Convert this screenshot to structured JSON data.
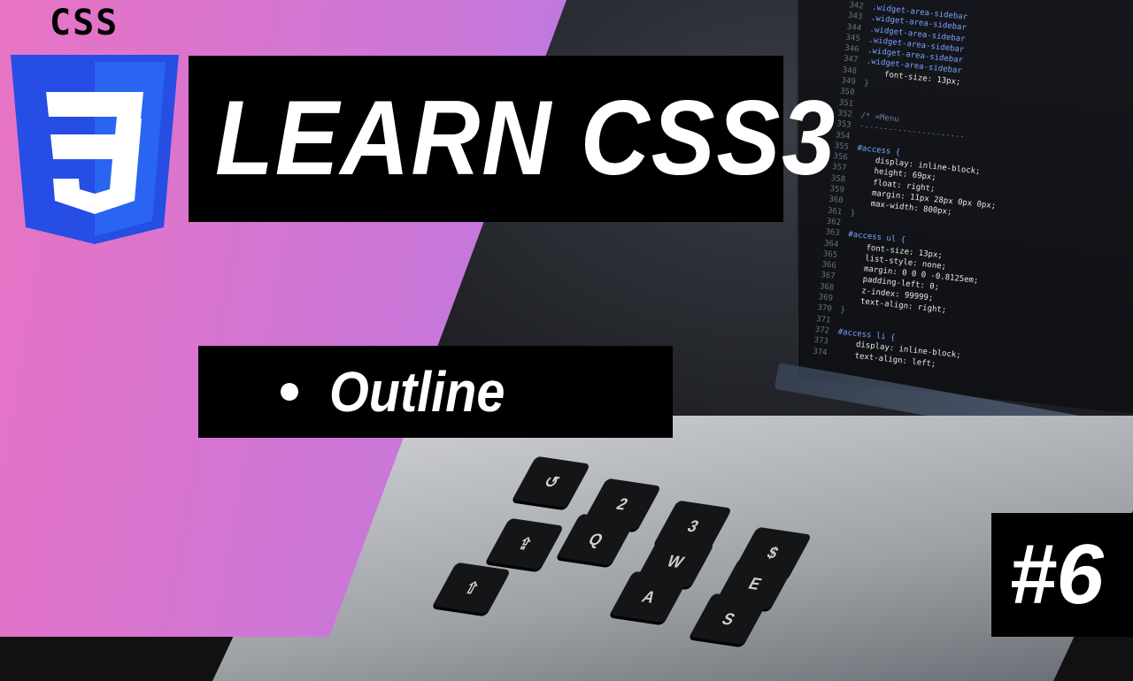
{
  "logo": {
    "text": "CSS",
    "icon": "css3-shield-icon",
    "colors": {
      "shield": "#264de4",
      "shield_light": "#2965f1"
    }
  },
  "title": "LEARN  CSS3",
  "topic": {
    "bullet": "•",
    "label": "Outline"
  },
  "episode": "#6",
  "colors": {
    "gradient_start": "#e873c4",
    "gradient_end": "#8a80ff",
    "banner": "#000000",
    "text": "#ffffff"
  },
  "code_lines": [
    {
      "n": "342",
      "text": ".widget-area-sidebar"
    },
    {
      "n": "343",
      "text": ".widget-area-sidebar"
    },
    {
      "n": "344",
      "text": ".widget-area-sidebar"
    },
    {
      "n": "345",
      "text": ".widget-area-sidebar"
    },
    {
      "n": "346",
      "text": ".widget-area-sidebar"
    },
    {
      "n": "347",
      "text": ".widget-area-sidebar"
    },
    {
      "n": "348",
      "text": "    font-size: 13px;"
    },
    {
      "n": "349",
      "text": "}"
    },
    {
      "n": "350",
      "text": ""
    },
    {
      "n": "351",
      "text": ""
    },
    {
      "n": "352",
      "text": "/* =Menu"
    },
    {
      "n": "353",
      "text": "----------------------"
    },
    {
      "n": "354",
      "text": ""
    },
    {
      "n": "355",
      "text": "#access {"
    },
    {
      "n": "356",
      "text": "    display: inline-block;"
    },
    {
      "n": "357",
      "text": "    height: 69px;"
    },
    {
      "n": "358",
      "text": "    float: right;"
    },
    {
      "n": "359",
      "text": "    margin: 11px 28px 0px 0px;"
    },
    {
      "n": "360",
      "text": "    max-width: 800px;"
    },
    {
      "n": "361",
      "text": "}"
    },
    {
      "n": "362",
      "text": ""
    },
    {
      "n": "363",
      "text": "#access ul {"
    },
    {
      "n": "364",
      "text": "    font-size: 13px;"
    },
    {
      "n": "365",
      "text": "    list-style: none;"
    },
    {
      "n": "366",
      "text": "    margin: 0 0 0 -0.8125em;"
    },
    {
      "n": "367",
      "text": "    padding-left: 0;"
    },
    {
      "n": "368",
      "text": "    z-index: 99999;"
    },
    {
      "n": "369",
      "text": "    text-align: right;"
    },
    {
      "n": "370",
      "text": "}"
    },
    {
      "n": "371",
      "text": ""
    },
    {
      "n": "372",
      "text": "#access li {"
    },
    {
      "n": "373",
      "text": "    display: inline-block;"
    },
    {
      "n": "374",
      "text": "    text-align: left;"
    }
  ],
  "keys": [
    "↺",
    "2",
    "3",
    "$",
    "Q",
    "W",
    "E",
    "A",
    "S",
    "⇪",
    "⇧"
  ]
}
